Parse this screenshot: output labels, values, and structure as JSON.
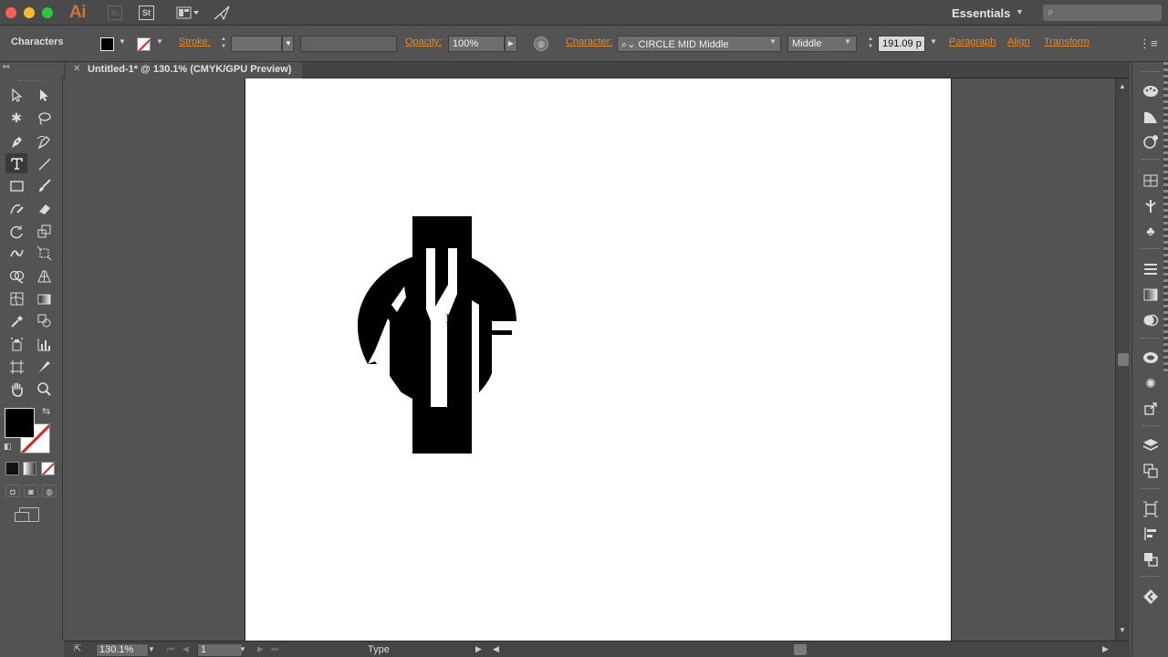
{
  "titlebar": {
    "app_logo": "Ai",
    "bridge_label": "Br",
    "stock_label": "St",
    "workspace": "Essentials",
    "search_placeholder": ""
  },
  "controlbar": {
    "panel_name": "Characters",
    "stroke_label": "Stroke:",
    "opacity_label": "Opacity:",
    "opacity_value": "100%",
    "character_label": "Character:",
    "font_family": "CIRCLE MID Middle",
    "font_style": "Middle",
    "font_size": "191.09 p",
    "paragraph": "Paragraph",
    "align": "Align",
    "transform": "Transform"
  },
  "document": {
    "tab_title": "Untitled-1* @ 130.1% (CMYK/GPU Preview)"
  },
  "statusbar": {
    "zoom": "130.1%",
    "page": "1",
    "tool": "Type"
  },
  "colors": {
    "accent": "#e28a2f",
    "fill": "#000000",
    "stroke_none": "#e02020",
    "artboard": "#ffffff",
    "ui_bg": "#535353"
  },
  "tools": [
    "selection-tool",
    "direct-selection-tool",
    "magic-wand-tool",
    "lasso-tool",
    "pen-tool",
    "curvature-tool",
    "type-tool",
    "line-segment-tool",
    "rectangle-tool",
    "paintbrush-tool",
    "shaper-tool",
    "eraser-tool",
    "rotate-tool",
    "scale-tool",
    "width-tool",
    "free-transform-tool",
    "shape-builder-tool",
    "perspective-grid-tool",
    "mesh-tool",
    "gradient-tool",
    "eyedropper-tool",
    "blend-tool",
    "symbol-sprayer-tool",
    "column-graph-tool",
    "artboard-tool",
    "slice-tool",
    "hand-tool",
    "zoom-tool"
  ]
}
